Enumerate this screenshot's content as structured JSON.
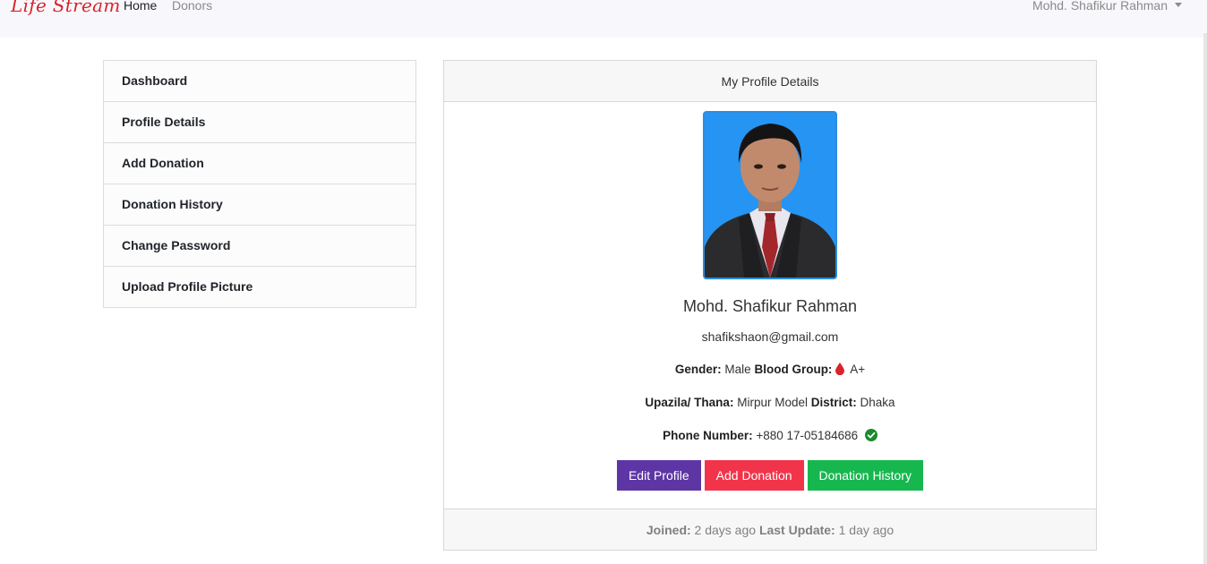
{
  "navbar": {
    "brand": "Life Stream",
    "links": [
      "Home",
      "Donors"
    ],
    "user_name": "Mohd. Shafikur Rahman"
  },
  "sidebar": {
    "items": [
      {
        "label": "Dashboard"
      },
      {
        "label": "Profile Details"
      },
      {
        "label": "Add Donation"
      },
      {
        "label": "Donation History"
      },
      {
        "label": "Change Password"
      },
      {
        "label": "Upload Profile Picture"
      }
    ]
  },
  "profile": {
    "header": "My Profile Details",
    "name": "Mohd. Shafikur Rahman",
    "email": "shafikshaon@gmail.com",
    "gender_label": "Gender:",
    "gender": "Male",
    "blood_group_label": "Blood Group:",
    "blood_group": "A+",
    "upazila_label": "Upazila/ Thana:",
    "upazila": "Mirpur Model",
    "district_label": "District:",
    "district": "Dhaka",
    "phone_label": "Phone Number:",
    "phone": "+880 17-05184686",
    "buttons": {
      "edit_profile": "Edit Profile",
      "add_donation": "Add Donation",
      "donation_history": "Donation History"
    },
    "footer": {
      "joined_label": "Joined:",
      "joined": "2 days ago",
      "last_update_label": "Last Update:",
      "last_update": "1 day ago"
    }
  },
  "icons": {
    "blood": "blood-drop-icon",
    "verified": "check-circle-icon",
    "user_menu": "caret-down-icon"
  },
  "colors": {
    "brand": "#d8232a",
    "edit_button": "#5e35a5",
    "add_donation_button": "#f2344a",
    "donation_history_button": "#17b74f",
    "verified": "#1a8a2e",
    "photo_border": "#2b8de0"
  }
}
